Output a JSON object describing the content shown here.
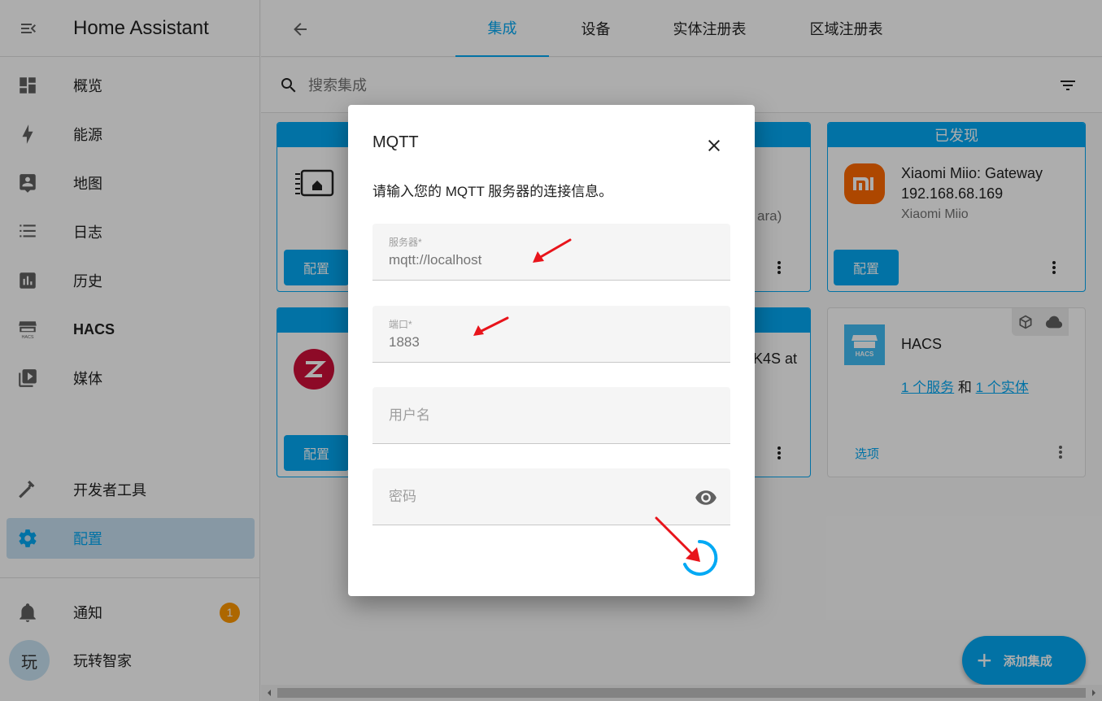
{
  "app": {
    "title": "Home Assistant"
  },
  "sidebar": {
    "items": [
      {
        "label": "概览",
        "icon": "dashboard-icon"
      },
      {
        "label": "能源",
        "icon": "lightning-icon"
      },
      {
        "label": "地图",
        "icon": "map-account-icon"
      },
      {
        "label": "日志",
        "icon": "list-icon"
      },
      {
        "label": "历史",
        "icon": "chart-box-icon"
      },
      {
        "label": "HACS",
        "icon": "hacs-icon"
      },
      {
        "label": "媒体",
        "icon": "play-box-icon"
      }
    ],
    "dev_tools": "开发者工具",
    "config": "配置",
    "notifications": "通知",
    "notifications_count": "1",
    "user_initial": "玩",
    "user_name": "玩转智家"
  },
  "topbar": {
    "tabs": [
      "集成",
      "设备",
      "实体注册表",
      "区域注册表"
    ],
    "active_tab": "集成"
  },
  "search": {
    "placeholder": "搜索集成"
  },
  "cards": {
    "xiaomi": {
      "header": "已发现",
      "title_line1": "Xiaomi Miio: Gateway",
      "title_line2": "192.168.68.169",
      "subtitle": "Xiaomi Miio",
      "button": "配置"
    },
    "card1": {
      "button": "配置"
    },
    "card2": {
      "partial_text": "ara)"
    },
    "card3": {
      "button": "配置"
    },
    "card4": {
      "partial_text": "K4S at"
    },
    "hacs": {
      "title": "HACS",
      "link_services": "1 个服务",
      "and": "和",
      "link_entities": "1 个实体",
      "options": "选项"
    }
  },
  "fab": {
    "label": "添加集成"
  },
  "dialog": {
    "title": "MQTT",
    "description": "请输入您的 MQTT 服务器的连接信息。",
    "fields": {
      "broker": {
        "label": "服务器*",
        "value": "mqtt://localhost"
      },
      "port": {
        "label": "端口*",
        "value": "1883"
      },
      "username": {
        "placeholder": "用户名"
      },
      "password": {
        "placeholder": "密码"
      }
    }
  },
  "colors": {
    "primary": "#03a9f4",
    "active_nav_bg": "#c7e0f2",
    "badge": "#ff9800",
    "xiaomi_orange": "#ff6900",
    "zigbee_red": "#d0103a",
    "annotation_arrow": "#e8141b"
  }
}
